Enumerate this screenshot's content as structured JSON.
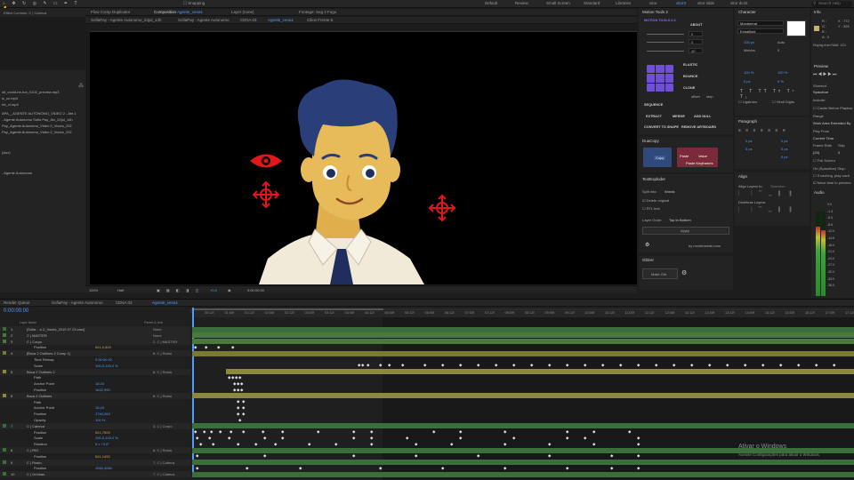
{
  "workspaces": [
    {
      "label": "Default",
      "active": false
    },
    {
      "label": "Review",
      "active": false
    },
    {
      "label": "Small Screen",
      "active": false
    },
    {
      "label": "Standard",
      "active": false
    },
    {
      "label": "Libraries",
      "active": false
    },
    {
      "label": "vitor",
      "active": false
    },
    {
      "label": "vitor3",
      "active": true
    },
    {
      "label": "vitor slide",
      "active": false
    },
    {
      "label": "vitor dc42",
      "active": false
    }
  ],
  "search": {
    "placeholder": "Search Help"
  },
  "toolbar": {
    "snapping": "Snapping"
  },
  "effect_controls": {
    "title": "Effect Controls: C | Cabeca"
  },
  "project_items": [
    "ult_could-be-fun_0102_preview.mp3",
    "ic_cc.mp4",
    "rte_vl.mp4",
    "APA__AGENTE AUTONOMO_VIDEO 2 - Ate.1",
    "- Agente Autonomo Sofia Pay_Alx_02jul_14h",
    "Pay_Agente Autonomo_Video 2_Voces_202",
    "Pay_Agente Autonomo_Video 2_Voces_202"
  ],
  "project_misc": {
    "label1": "(Aux)",
    "label2": "- Agente Autonomo"
  },
  "comp_tabs": {
    "flow": "Flow Comp Duplicator",
    "composition_prefix": "Composition",
    "composition_name": "Agente_cena1",
    "layer_label": "Layer (none)",
    "footage_label": "Footage: Seg 2 Fogo",
    "breadcrumbs": [
      "SofiaPay - Agente Autonomo_24jul_13h",
      "SofiaPay - Agente Autonomo",
      "CENA 03",
      "Agente_cena1",
      "Cilios Frente E"
    ]
  },
  "viewer_bar": {
    "zoom": "100%",
    "quality": "Half",
    "time": "0:00:00:00",
    "plus": "+0.0"
  },
  "right_top_tabs": {
    "motion_tools": "Motion Tools 2",
    "character": "Character",
    "info": "Info"
  },
  "motion_tools": {
    "title": "MOTION TOOLS 2.0",
    "about": "ABOUT",
    "values": [
      "0",
      "0",
      "40"
    ],
    "labels": {
      "elastic": "ELASTIC",
      "bounce": "BOUNCE",
      "clone": "CLONE",
      "sequence": "SEQUENCE",
      "offset": "offset",
      "step": "step",
      "extract": "EXTRACT",
      "merge": "MERGE",
      "add_null": "ADD NULL",
      "convert_shape": "CONVERT TO SHAPE",
      "remove_artboard": "REMOVE ARTBOARD"
    }
  },
  "character": {
    "font": "Montserrat",
    "style": "ExtraBold",
    "size": "105 px",
    "leading": "Auto",
    "kern": "Metrics",
    "track": "0",
    "vscale": "100 %",
    "hscale": "100 %",
    "baseline": "0 px",
    "tsume": "0 %",
    "ligatures": "Ligatures",
    "hindi": "Hindi Digits"
  },
  "info": {
    "r": "R :",
    "g": "G :",
    "b": "B :",
    "a": "A : 0",
    "x": "X : 772",
    "y": "Y : 328",
    "playing": "Playing from RAM: 121/",
    "preview_title": "Preview",
    "shortcut": "Shortcut",
    "shortcut_val": "Spacebar",
    "include": "Include:",
    "cache": "Cache Before Playbac",
    "range": "Range",
    "range_val": "Work Area Extended By",
    "play_from": "Play From",
    "play_from_val": "Current Time",
    "frame_rate": "Frame Rate",
    "skip": "Skip",
    "fr_val": "(24)",
    "skip_val": "0",
    "full_screen": "Full Screen",
    "stop_label": "On (Spacebar) Stop:",
    "if_caching": "If caching, play cach",
    "move_time": "Move time to preview",
    "audio_title": "Audio"
  },
  "paragraph": {
    "title": "Paragraph",
    "vals": [
      "0 px",
      "0 px",
      "0 px",
      "0 px",
      "0 px"
    ]
  },
  "duacopy": {
    "title": "DuaCopy",
    "copy": "Copy",
    "paste": "Paste",
    "value": "Value",
    "paste_keyframes": "Paste Keyframes"
  },
  "align": {
    "title": "Align",
    "align_to": "Align Layers to:",
    "selection": "Selection",
    "distribute": "Distribute Layers:"
  },
  "textexploder": {
    "title": "TextExploder",
    "split_into": "Split into:",
    "split_val": "Words",
    "delete_original": "Delete original",
    "rtl": "RTL text",
    "layer_order": "Layer Order:",
    "layer_order_val": "Top to Bottom",
    "apply": "Apply",
    "by": "by montereelab.com"
  },
  "glitch": {
    "title": "Glitzer",
    "make": "Make Glit"
  },
  "timeline": {
    "tabs": [
      "Render Queue",
      "SofiaPay - Agente Autonomo",
      "CENA 03",
      "Agente_cena1"
    ],
    "time": "0:00:00:00",
    "col_layer": "Layer Name",
    "col_parent": "Parent & Link",
    "ticks": [
      "00:12f",
      "01:00f",
      "01:12f",
      "02:00f",
      "02:12f",
      "03:00f",
      "03:12f",
      "04:00f",
      "04:12f",
      "05:00f",
      "05:12f",
      "06:00f",
      "06:12f",
      "07:00f",
      "07:12f",
      "08:00f",
      "08:12f",
      "09:00f",
      "09:12f",
      "10:00f",
      "10:12f",
      "11:00f",
      "11:12f",
      "12:00f",
      "12:12f",
      "13:00f",
      "13:12f",
      "14:00f",
      "14:12f",
      "15:00f",
      "16:12f",
      "17:00f",
      "17:12f"
    ],
    "layers": [
      {
        "num": "1",
        "name": "[Sofia ...o 2_Voces_2019 07 23.wav]",
        "val": "",
        "parent": "None"
      },
      {
        "num": "2",
        "name": "C | MASTER",
        "val": "",
        "parent": "None"
      },
      {
        "num": "3",
        "name": "C | Corpo",
        "val": "",
        "parent": "2. C | MASTER"
      },
      {
        "num": "",
        "name": "Position",
        "val": "541,0,820",
        "parent": ""
      },
      {
        "num": "4",
        "name": "[Boca 2 Outlines 2 Comp 1]",
        "val": "",
        "parent": "8. C | Rosto"
      },
      {
        "num": "",
        "name": "Time Remap",
        "val": "0:00:00:00",
        "parent": ""
      },
      {
        "num": "",
        "name": "Scale",
        "val": "100,0,100,0 %",
        "parent": ""
      },
      {
        "num": "5",
        "name": "Boca 2 Outlines 2",
        "val": "",
        "parent": "8. C | Rosto"
      },
      {
        "num": "",
        "name": "Path",
        "val": "",
        "parent": ""
      },
      {
        "num": "",
        "name": "Anchor Point",
        "val": "18,43",
        "parent": ""
      },
      {
        "num": "",
        "name": "Position",
        "val": "1622,950",
        "parent": ""
      },
      {
        "num": "6",
        "name": "Boca 2 Outlines",
        "val": "",
        "parent": "8. C | Rosto"
      },
      {
        "num": "",
        "name": "Path",
        "val": "",
        "parent": ""
      },
      {
        "num": "",
        "name": "Anchor Point",
        "val": "18,43",
        "parent": ""
      },
      {
        "num": "",
        "name": "Position",
        "val": "1740,263",
        "parent": ""
      },
      {
        "num": "",
        "name": "Opacity",
        "val": "100 %",
        "parent": ""
      },
      {
        "num": "7",
        "name": "C | Cabeca",
        "val": "",
        "parent": "3. C | Corpo"
      },
      {
        "num": "",
        "name": "Position",
        "val": "541,7500",
        "parent": ""
      },
      {
        "num": "",
        "name": "Scale",
        "val": "100,0,100,0 %",
        "parent": ""
      },
      {
        "num": "",
        "name": "Rotation",
        "val": "0 x +3,0°",
        "parent": ""
      },
      {
        "num": "8",
        "name": "C | RIG",
        "val": "",
        "parent": "6. C | Rosto"
      },
      {
        "num": "",
        "name": "Position",
        "val": "541,1492",
        "parent": ""
      },
      {
        "num": "9",
        "name": "C | Rosto",
        "val": "",
        "parent": "7. C | Cabeca"
      },
      {
        "num": "",
        "name": "Position",
        "val": "1560,4060",
        "parent": ""
      },
      {
        "num": "10",
        "name": "C | Orelhas",
        "val": "",
        "parent": "7. C | Cabeca"
      }
    ]
  },
  "watermark": {
    "title": "Ativar o Windows",
    "sub": "Acesse Configurações para ativar o Windows."
  },
  "audio_scale": [
    "0.0",
    "-1.3",
    "-6.0",
    "-8.6",
    "-12.0",
    "-14.5",
    "-18.0",
    "-21.0",
    "-24.0",
    "-27.0",
    "-30.0",
    "-33.0",
    "-36.0"
  ],
  "colors": {
    "accent": "#4f9bff",
    "purple": "#6e4fd6",
    "layer_green": "#3a6e3a",
    "layer_yellow": "#8a8a3a",
    "skin": "#e8bb5a",
    "hair": "#2a3f7a",
    "shirt": "#f2ead8",
    "eye_red": "#e2161b"
  }
}
